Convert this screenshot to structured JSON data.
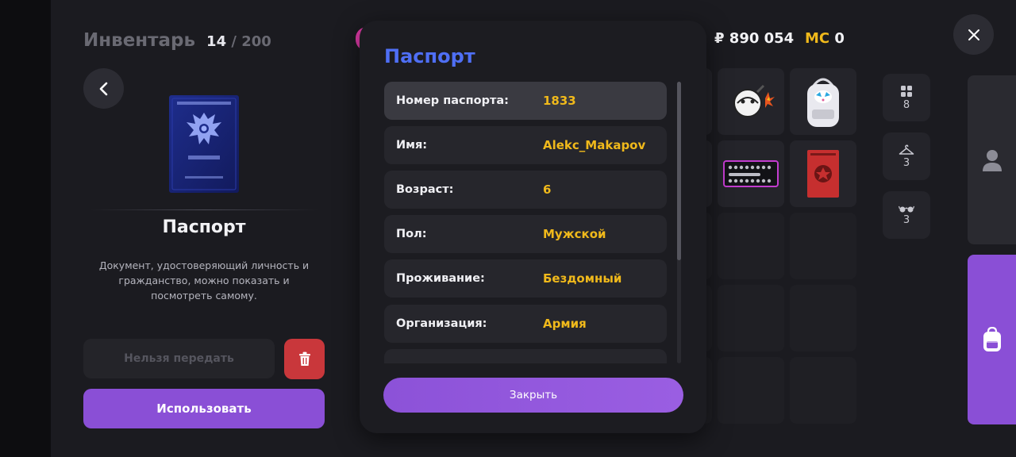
{
  "inventory": {
    "title": "Инвентарь",
    "count_current": "14",
    "count_sep": "/",
    "count_max": "200"
  },
  "item": {
    "name": "Паспорт",
    "description": "Документ, удостоверяющий личность и гражданство, можно показать и посмотреть самому.",
    "image_icon": "passport-book-icon",
    "transfer_label": "Нельзя передать",
    "use_label": "Использовать"
  },
  "balance": {
    "money": "₽ 890 054",
    "mc_label": "MC",
    "mc_value": "0"
  },
  "categories": [
    {
      "icon": "grid-icon",
      "count": "8"
    },
    {
      "icon": "hanger-icon",
      "count": "3"
    },
    {
      "icon": "glasses-icon",
      "count": "3"
    }
  ],
  "modal": {
    "title": "Паспорт",
    "rows": [
      {
        "key": "Номер паспорта:",
        "value": "1833"
      },
      {
        "key": "Имя:",
        "value": "Alekc_Makapov"
      },
      {
        "key": "Возраст:",
        "value": "6"
      },
      {
        "key": "Пол:",
        "value": "Мужской"
      },
      {
        "key": "Проживание:",
        "value": "Бездомный"
      },
      {
        "key": "Организация:",
        "value": "Армия"
      },
      {
        "key": "",
        "value": ""
      }
    ],
    "close_label": "Закрыть"
  },
  "colors": {
    "accent_purple": "#8a4fd6",
    "value_yellow": "#f0b91b",
    "title_blue": "#4f6ff5",
    "delete_red": "#c9373b"
  }
}
